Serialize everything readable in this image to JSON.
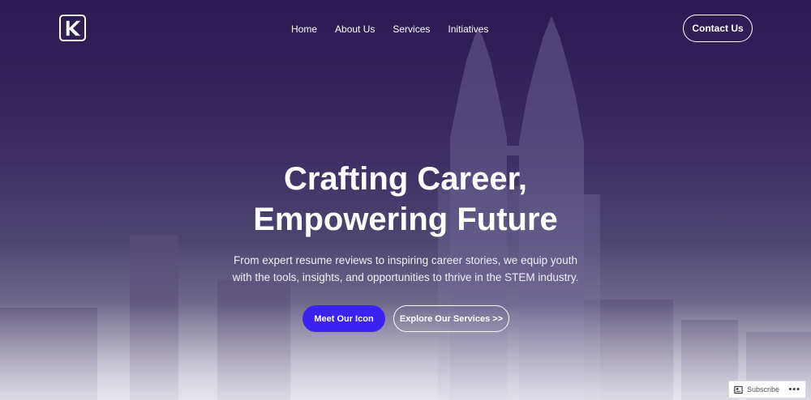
{
  "header": {
    "logo_alt": "K",
    "nav": [
      {
        "label": "Home"
      },
      {
        "label": "About Us"
      },
      {
        "label": "Services"
      },
      {
        "label": "Initiatives"
      }
    ],
    "contact_label": "Contact Us"
  },
  "hero": {
    "title_line1": "Crafting Career,",
    "title_line2": "Empowering Future",
    "subtitle_line1": "From expert resume reviews to inspiring career stories, we equip youth",
    "subtitle_line2": "with the tools, insights, and opportunities to thrive in the STEM industry.",
    "primary_cta": "Meet Our Icon",
    "secondary_cta": "Explore Our Services >>"
  },
  "subscribe_bar": {
    "label": "Subscribe",
    "icon": "reader-icon",
    "more_icon": "more-dots-icon"
  },
  "colors": {
    "primary_button": "#3b22f0",
    "overlay_top": "#2b1a52"
  }
}
